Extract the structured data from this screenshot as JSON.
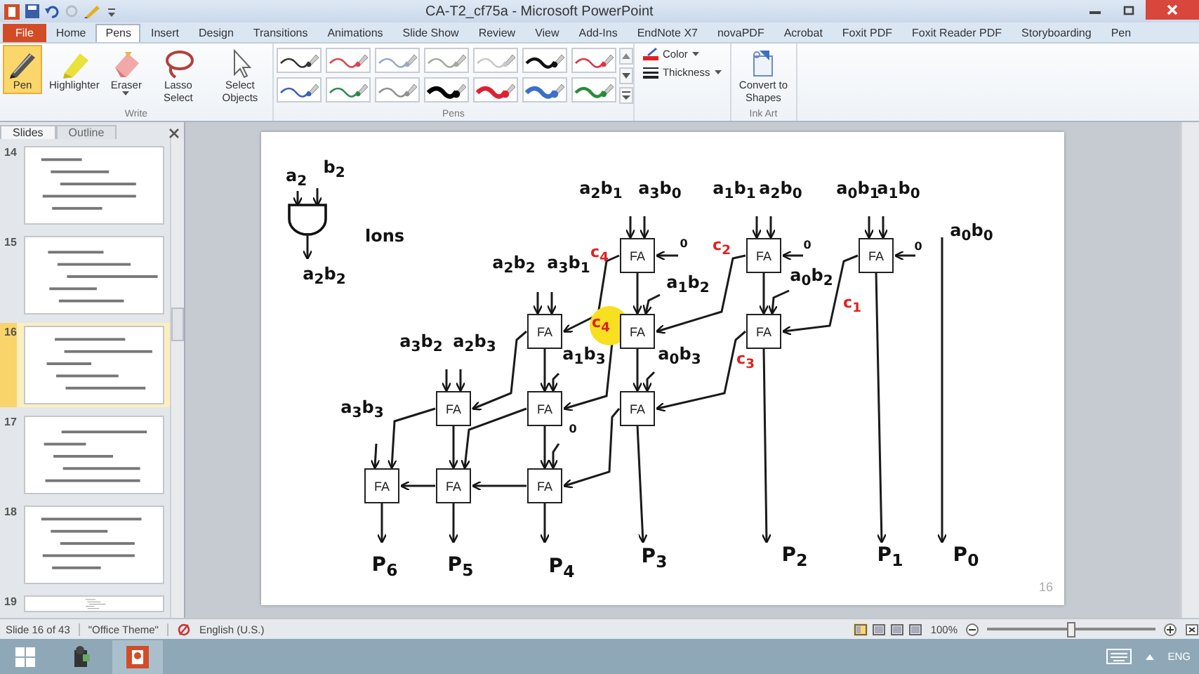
{
  "window": {
    "title": "CA-T2_cf75a - Microsoft PowerPoint"
  },
  "tabs": [
    {
      "label": "File",
      "kind": "file",
      "selected": false
    },
    {
      "label": "Home",
      "kind": "tab",
      "selected": false
    },
    {
      "label": "Pens",
      "kind": "tab",
      "selected": true
    },
    {
      "label": "Insert",
      "kind": "tab",
      "selected": false
    },
    {
      "label": "Design",
      "kind": "tab",
      "selected": false
    },
    {
      "label": "Transitions",
      "kind": "tab",
      "selected": false
    },
    {
      "label": "Animations",
      "kind": "tab",
      "selected": false
    },
    {
      "label": "Slide Show",
      "kind": "tab",
      "selected": false
    },
    {
      "label": "Review",
      "kind": "tab",
      "selected": false
    },
    {
      "label": "View",
      "kind": "tab",
      "selected": false
    },
    {
      "label": "Add-Ins",
      "kind": "tab",
      "selected": false
    },
    {
      "label": "EndNote X7",
      "kind": "tab",
      "selected": false
    },
    {
      "label": "novaPDF",
      "kind": "tab",
      "selected": false
    },
    {
      "label": "Acrobat",
      "kind": "tab",
      "selected": false
    },
    {
      "label": "Foxit PDF",
      "kind": "tab",
      "selected": false
    },
    {
      "label": "Foxit Reader PDF",
      "kind": "tab",
      "selected": false
    },
    {
      "label": "Storyboarding",
      "kind": "tab",
      "selected": false
    },
    {
      "label": "Pen",
      "kind": "tab",
      "selected": false
    }
  ],
  "ribbon": {
    "write": {
      "label": "Write",
      "tools": [
        {
          "label": "Pen",
          "kind": "pen",
          "selected": true
        },
        {
          "label": "Highlighter",
          "kind": "highlighter",
          "selected": false
        },
        {
          "label": "Eraser",
          "kind": "eraser",
          "selected": false
        },
        {
          "label": "Lasso Select",
          "kind": "lasso",
          "selected": false
        },
        {
          "label": "Select Objects",
          "kind": "pointer",
          "selected": false
        }
      ]
    },
    "pens": {
      "label": "Pens",
      "swatches": [
        {
          "color": "#333333",
          "kind": "thin"
        },
        {
          "color": "#e0404a",
          "kind": "thin"
        },
        {
          "color": "#9aa8c8",
          "kind": "thin"
        },
        {
          "color": "#a0aaa0",
          "kind": "thin"
        },
        {
          "color": "#c8c8c8",
          "kind": "thin"
        },
        {
          "color": "#111111",
          "kind": "medium"
        },
        {
          "color": "#e03040",
          "kind": "thin"
        },
        {
          "color": "#3a60b8",
          "kind": "thin"
        },
        {
          "color": "#2a8a4a",
          "kind": "thin"
        },
        {
          "color": "#909090",
          "kind": "thin"
        },
        {
          "color": "#000000",
          "kind": "thick"
        },
        {
          "color": "#e02030",
          "kind": "thick"
        },
        {
          "color": "#3a70c8",
          "kind": "thick"
        },
        {
          "color": "#2a8a3a",
          "kind": "medium"
        }
      ]
    },
    "options": [
      {
        "label": "Color"
      },
      {
        "label": "Thickness"
      }
    ],
    "ink_art": {
      "label": "Ink Art",
      "button": "Convert to Shapes"
    }
  },
  "slides_pane": {
    "tabs": [
      {
        "label": "Slides",
        "selected": true
      },
      {
        "label": "Outline",
        "selected": false
      }
    ],
    "thumbnails": [
      {
        "number": "14",
        "selected": false
      },
      {
        "number": "15",
        "selected": false
      },
      {
        "number": "16",
        "selected": true
      },
      {
        "number": "17",
        "selected": false
      },
      {
        "number": "18",
        "selected": false
      },
      {
        "number": "19",
        "selected": false
      }
    ]
  },
  "slide": {
    "number": "16",
    "gate": {
      "inputs": [
        "a$_{2}$",
        "b$_{2}$"
      ],
      "output": "a$_{2}$b$_{2}$"
    },
    "note": "lons",
    "adders": [
      {
        "label": "FA",
        "highlighted": false
      },
      {
        "label": "FA",
        "highlighted": false
      },
      {
        "label": "FA",
        "highlighted": false
      },
      {
        "label": "FA",
        "highlighted": false
      },
      {
        "label": "FA",
        "highlighted": true
      },
      {
        "label": "FA",
        "highlighted": false
      },
      {
        "label": "FA",
        "highlighted": false
      },
      {
        "label": "FA",
        "highlighted": false
      },
      {
        "label": "FA",
        "highlighted": false
      },
      {
        "label": "FA",
        "highlighted": false
      },
      {
        "label": "FA",
        "highlighted": false
      },
      {
        "label": "FA",
        "highlighted": false
      }
    ],
    "terms": [
      "a$_{2}$b$_{1}$",
      "a$_{3}$b$_{0}$",
      "a$_{1}$b$_{1}$",
      "a$_{2}$b$_{0}$",
      "a$_{0}$b$_{1}$",
      "a$_{1}$b$_{0}$",
      "a$_{0}$b$_{0}$",
      "a$_{2}$b$_{2}$",
      "a$_{3}$b$_{1}$",
      "a$_{1}$b$_{2}$",
      "a$_{0}$b$_{2}$",
      "a$_{3}$b$_{2}$",
      "a$_{2}$b$_{3}$",
      "a$_{1}$b$_{3}$",
      "a$_{0}$b$_{3}$",
      "a$_{3}$b$_{3}$"
    ],
    "carries": [
      "c$_{4}$",
      "c$_{2}$",
      "c$_{4}$",
      "c$_{1}$",
      "c$_{3}$"
    ],
    "zeros": [
      "0",
      "0",
      "0",
      "0"
    ],
    "outputs": [
      "P$_{6}$",
      "P$_{5}$",
      "P$_{4}$",
      "P$_{3}$",
      "P$_{2}$",
      "P$_{1}$",
      "P$_{0}$"
    ]
  },
  "status_bar": {
    "slide": "Slide 16 of 43",
    "theme": "\"Office Theme\"",
    "language": "English (U.S.)",
    "zoom": "100%",
    "level": 0.5
  },
  "taskbar": {
    "language": "ENG"
  }
}
